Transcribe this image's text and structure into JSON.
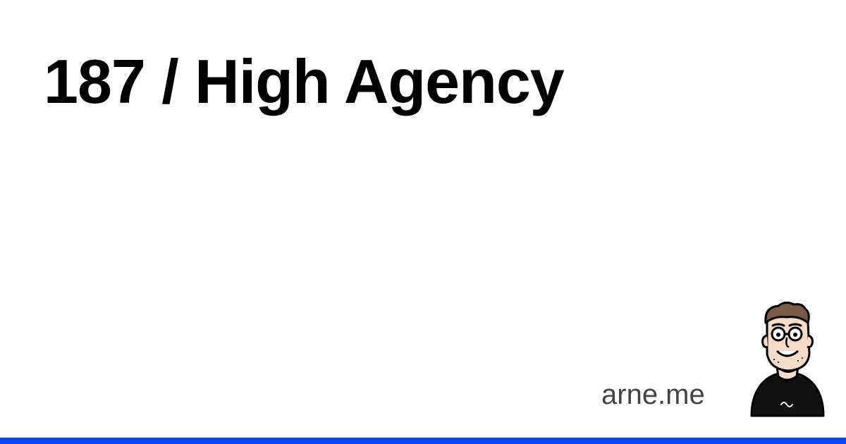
{
  "title": "187 / High Agency",
  "site": {
    "name": "arne.me"
  },
  "avatar": {
    "icon": "avatar-illustration-icon"
  },
  "colors": {
    "background": "#ffffff",
    "title": "#000000",
    "site_name": "#444444",
    "accent_bar": "#0a47f5",
    "shirt": "#111111",
    "skin": "#f5dcc8",
    "hair": "#7a5a48"
  }
}
